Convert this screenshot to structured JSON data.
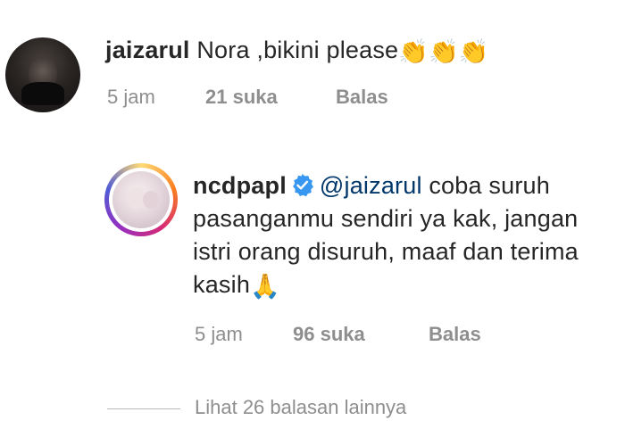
{
  "comment": {
    "username": "jaizarul",
    "text": "Nora ,bikini please",
    "emoji": "👏👏👏",
    "avatar_icon": "user-avatar-dark",
    "time": "5 jam",
    "likes": "21 suka",
    "reply_label": "Balas"
  },
  "reply": {
    "username": "ncdpapl",
    "verified_icon": "verified-badge-icon",
    "verified_color": "#3897f0",
    "mention": "@jaizarul",
    "text": "coba suruh pasanganmu sendiri ya kak, jangan istri orang disuruh, maaf dan terima kasih",
    "emoji": "🙏",
    "time": "5 jam",
    "likes": "96 suka",
    "reply_label": "Balas"
  },
  "view_more": {
    "label": "Lihat 26 balasan lainnya"
  },
  "colors": {
    "text": "#262626",
    "muted": "#8e8e8e",
    "mention": "#00376b",
    "story_ring": [
      "#feda75",
      "#fa7e1e",
      "#d62976",
      "#962fbf",
      "#4f5bd5"
    ]
  }
}
